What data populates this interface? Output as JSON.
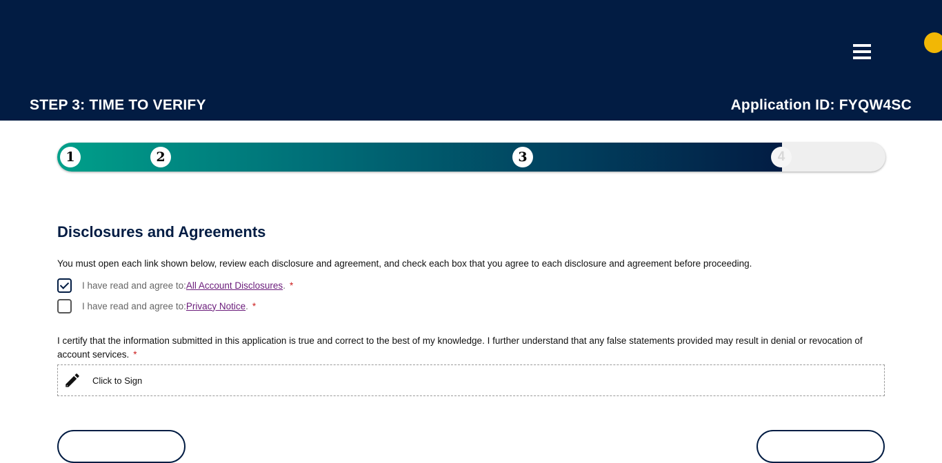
{
  "header": {
    "step_title": "STEP 3: TIME TO VERIFY",
    "application_id": "Application ID: FYQW4SC",
    "menu_icon": "hamburger-menu-icon",
    "background_color": "#021c43"
  },
  "progress": {
    "steps": [
      "1",
      "2",
      "3",
      "4"
    ],
    "completed_fraction": 0.875,
    "fill_colors": [
      "#00a08a",
      "#021c43"
    ]
  },
  "disclosures": {
    "title": "Disclosures and Agreements",
    "intro": "You must open each link shown below, review each disclosure and agreement, and check each box that you agree to each disclosure and agreement before proceeding.",
    "items": [
      {
        "prefix": "I have read and agree to: ",
        "link": "All Account Disclosures",
        "suffix": ".",
        "required": "*",
        "checked": true
      },
      {
        "prefix": "I have read and agree to: ",
        "link": "Privacy Notice",
        "suffix": ".",
        "required": "*",
        "checked": false
      }
    ]
  },
  "certification": {
    "text": "I certify that the information submitted in this application is true and correct to the best of my knowledge. I further understand that any false statements provided may result in denial or revocation of account services.",
    "required": "*",
    "sign_label": "Click to Sign",
    "sign_icon": "pencil-icon"
  },
  "colors": {
    "accent": "#021c43",
    "link": "#6a1b7a",
    "required": "#cc1f1f"
  }
}
